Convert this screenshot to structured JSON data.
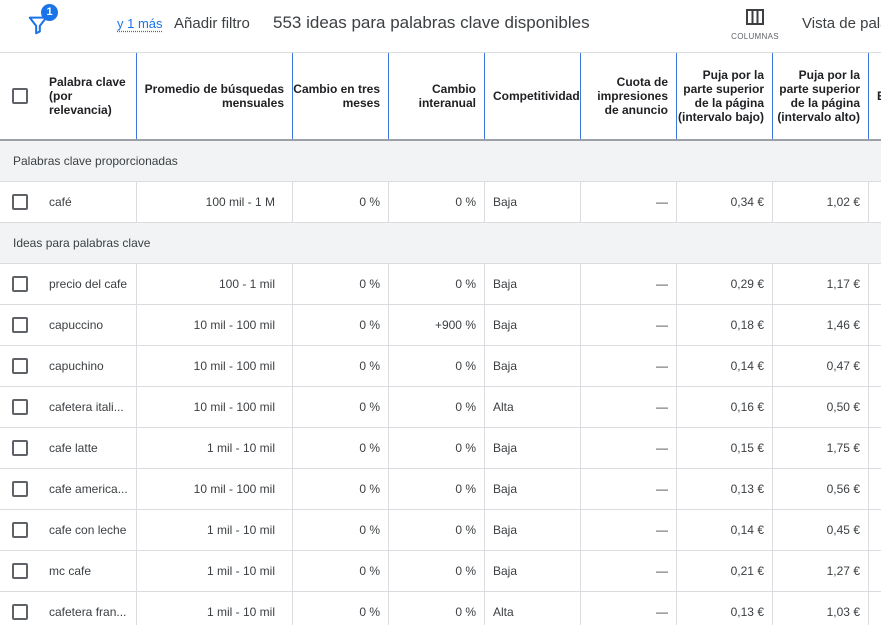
{
  "toolbar": {
    "filter_count": "1",
    "more_link": "y 1 más",
    "add_filter": "Añadir filtro",
    "ideas_count": "553 ideas para palabras clave disponibles",
    "columns_label": "COLUMNAS",
    "view_label": "Vista de pala"
  },
  "headers": {
    "keyword": "Palabra clave (por relevancia)",
    "avg_searches": "Promedio de búsquedas mensuales",
    "three_month": "Cambio en tres meses",
    "yoy": "Cambio interanual",
    "competition": "Competitividad",
    "impression_share": "Cuota de impresiones de anuncio",
    "bid_low": "Puja por la parte superior de la página (intervalo bajo)",
    "bid_high": "Puja por la parte superior de la página (intervalo alto)",
    "next_col": "E"
  },
  "sections": {
    "provided": "Palabras clave proporcionadas",
    "ideas": "Ideas para palabras clave"
  },
  "provided_rows": [
    {
      "keyword": "café",
      "searches": "100 mil - 1 M",
      "three_month": "0 %",
      "yoy": "0 %",
      "competition": "Baja",
      "impression_share": "—",
      "bid_low": "0,34 €",
      "bid_high": "1,02 €"
    }
  ],
  "idea_rows": [
    {
      "keyword": "precio del cafe",
      "searches": "100 - 1 mil",
      "three_month": "0 %",
      "yoy": "0 %",
      "competition": "Baja",
      "impression_share": "—",
      "bid_low": "0,29 €",
      "bid_high": "1,17 €"
    },
    {
      "keyword": "capuccino",
      "searches": "10 mil - 100 mil",
      "three_month": "0 %",
      "yoy": "+900 %",
      "competition": "Baja",
      "impression_share": "—",
      "bid_low": "0,18 €",
      "bid_high": "1,46 €"
    },
    {
      "keyword": "capuchino",
      "searches": "10 mil - 100 mil",
      "three_month": "0 %",
      "yoy": "0 %",
      "competition": "Baja",
      "impression_share": "—",
      "bid_low": "0,14 €",
      "bid_high": "0,47 €"
    },
    {
      "keyword": "cafetera itali...",
      "searches": "10 mil - 100 mil",
      "three_month": "0 %",
      "yoy": "0 %",
      "competition": "Alta",
      "impression_share": "—",
      "bid_low": "0,16 €",
      "bid_high": "0,50 €"
    },
    {
      "keyword": "cafe latte",
      "searches": "1 mil - 10 mil",
      "three_month": "0 %",
      "yoy": "0 %",
      "competition": "Baja",
      "impression_share": "—",
      "bid_low": "0,15 €",
      "bid_high": "1,75 €"
    },
    {
      "keyword": "cafe america...",
      "searches": "10 mil - 100 mil",
      "three_month": "0 %",
      "yoy": "0 %",
      "competition": "Baja",
      "impression_share": "—",
      "bid_low": "0,13 €",
      "bid_high": "0,56 €"
    },
    {
      "keyword": "cafe con leche",
      "searches": "1 mil - 10 mil",
      "three_month": "0 %",
      "yoy": "0 %",
      "competition": "Baja",
      "impression_share": "—",
      "bid_low": "0,14 €",
      "bid_high": "0,45 €"
    },
    {
      "keyword": "mc cafe",
      "searches": "1 mil - 10 mil",
      "three_month": "0 %",
      "yoy": "0 %",
      "competition": "Baja",
      "impression_share": "—",
      "bid_low": "0,21 €",
      "bid_high": "1,27 €"
    },
    {
      "keyword": "cafetera fran...",
      "searches": "1 mil - 10 mil",
      "three_month": "0 %",
      "yoy": "0 %",
      "competition": "Alta",
      "impression_share": "—",
      "bid_low": "0,13 €",
      "bid_high": "1,03 €"
    }
  ]
}
